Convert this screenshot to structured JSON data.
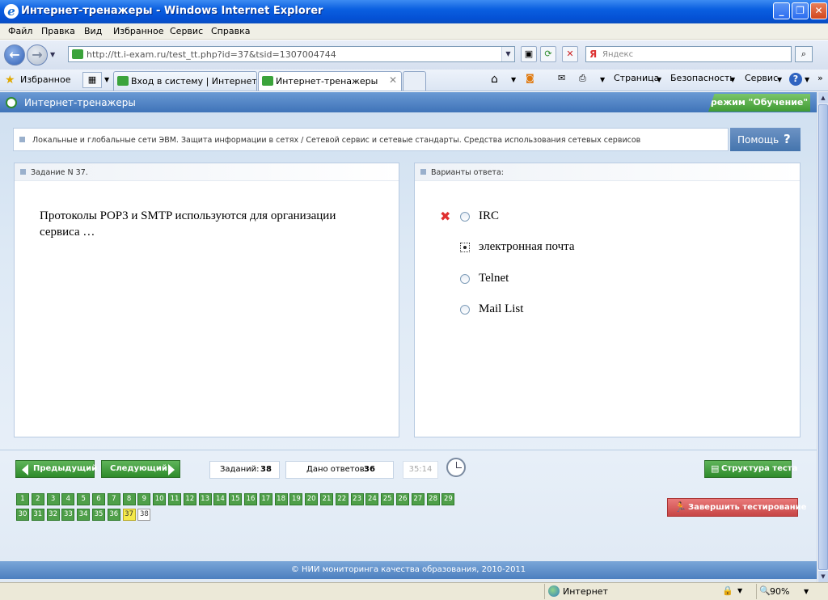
{
  "window": {
    "title": "Интернет-тренажеры - Windows Internet Explorer"
  },
  "menu": [
    "Файл",
    "Правка",
    "Вид",
    "Избранное",
    "Сервис",
    "Справка"
  ],
  "address": {
    "url": "http://tt.i-exam.ru/test_tt.php?id=37&tsid=1307004744"
  },
  "search": {
    "placeholder": "Яндекс"
  },
  "favorites": {
    "label": "Избранное"
  },
  "tabs": [
    {
      "label": "Вход в систему | Интернет-...",
      "active": false
    },
    {
      "label": "Интернет-тренажеры",
      "active": true
    }
  ],
  "commands": {
    "page": "Страница",
    "security": "Безопасность",
    "tools": "Сервис"
  },
  "app": {
    "title": "Интернет-тренажеры",
    "mode": "режим \"Обучение\""
  },
  "breadcrumb": "Локальные и глобальные сети ЭВМ. Защита информации в сетях / Сетевой сервис и сетевые стандарты. Средства использования сетевых сервисов",
  "help": {
    "label": "Помощь",
    "icon": "?"
  },
  "task": {
    "header": "Задание N 37.",
    "question": "Протоколы POP3 и SMTP используются для организации сервиса …"
  },
  "answers": {
    "header": "Варианты ответа:",
    "options": [
      {
        "label": "IRC",
        "wrong": true,
        "selected": false
      },
      {
        "label": "электронная почта",
        "wrong": false,
        "selected": true
      },
      {
        "label": "Telnet",
        "wrong": false,
        "selected": false
      },
      {
        "label": "Mail List",
        "wrong": false,
        "selected": false
      }
    ]
  },
  "nav": {
    "prev": "Предыдущий",
    "next": "Следующий",
    "tasks_label": "Заданий:",
    "tasks_count": "38",
    "answered_label": "Дано ответов:",
    "answered_count": "36",
    "timer": "35:14",
    "structure": "Структура теста",
    "finish": "Завершить тестирование"
  },
  "question_numbers": {
    "total": 38,
    "current": 37,
    "unanswered": [
      38
    ]
  },
  "footer": "© НИИ мониторинга качества образования, 2010-2011",
  "status": {
    "zone": "Интернет",
    "zoom": "90%"
  },
  "colors": {
    "accent": "#4474ad",
    "answered": "#4f9f49",
    "current": "#f4e94a",
    "finish": "#c74545"
  }
}
